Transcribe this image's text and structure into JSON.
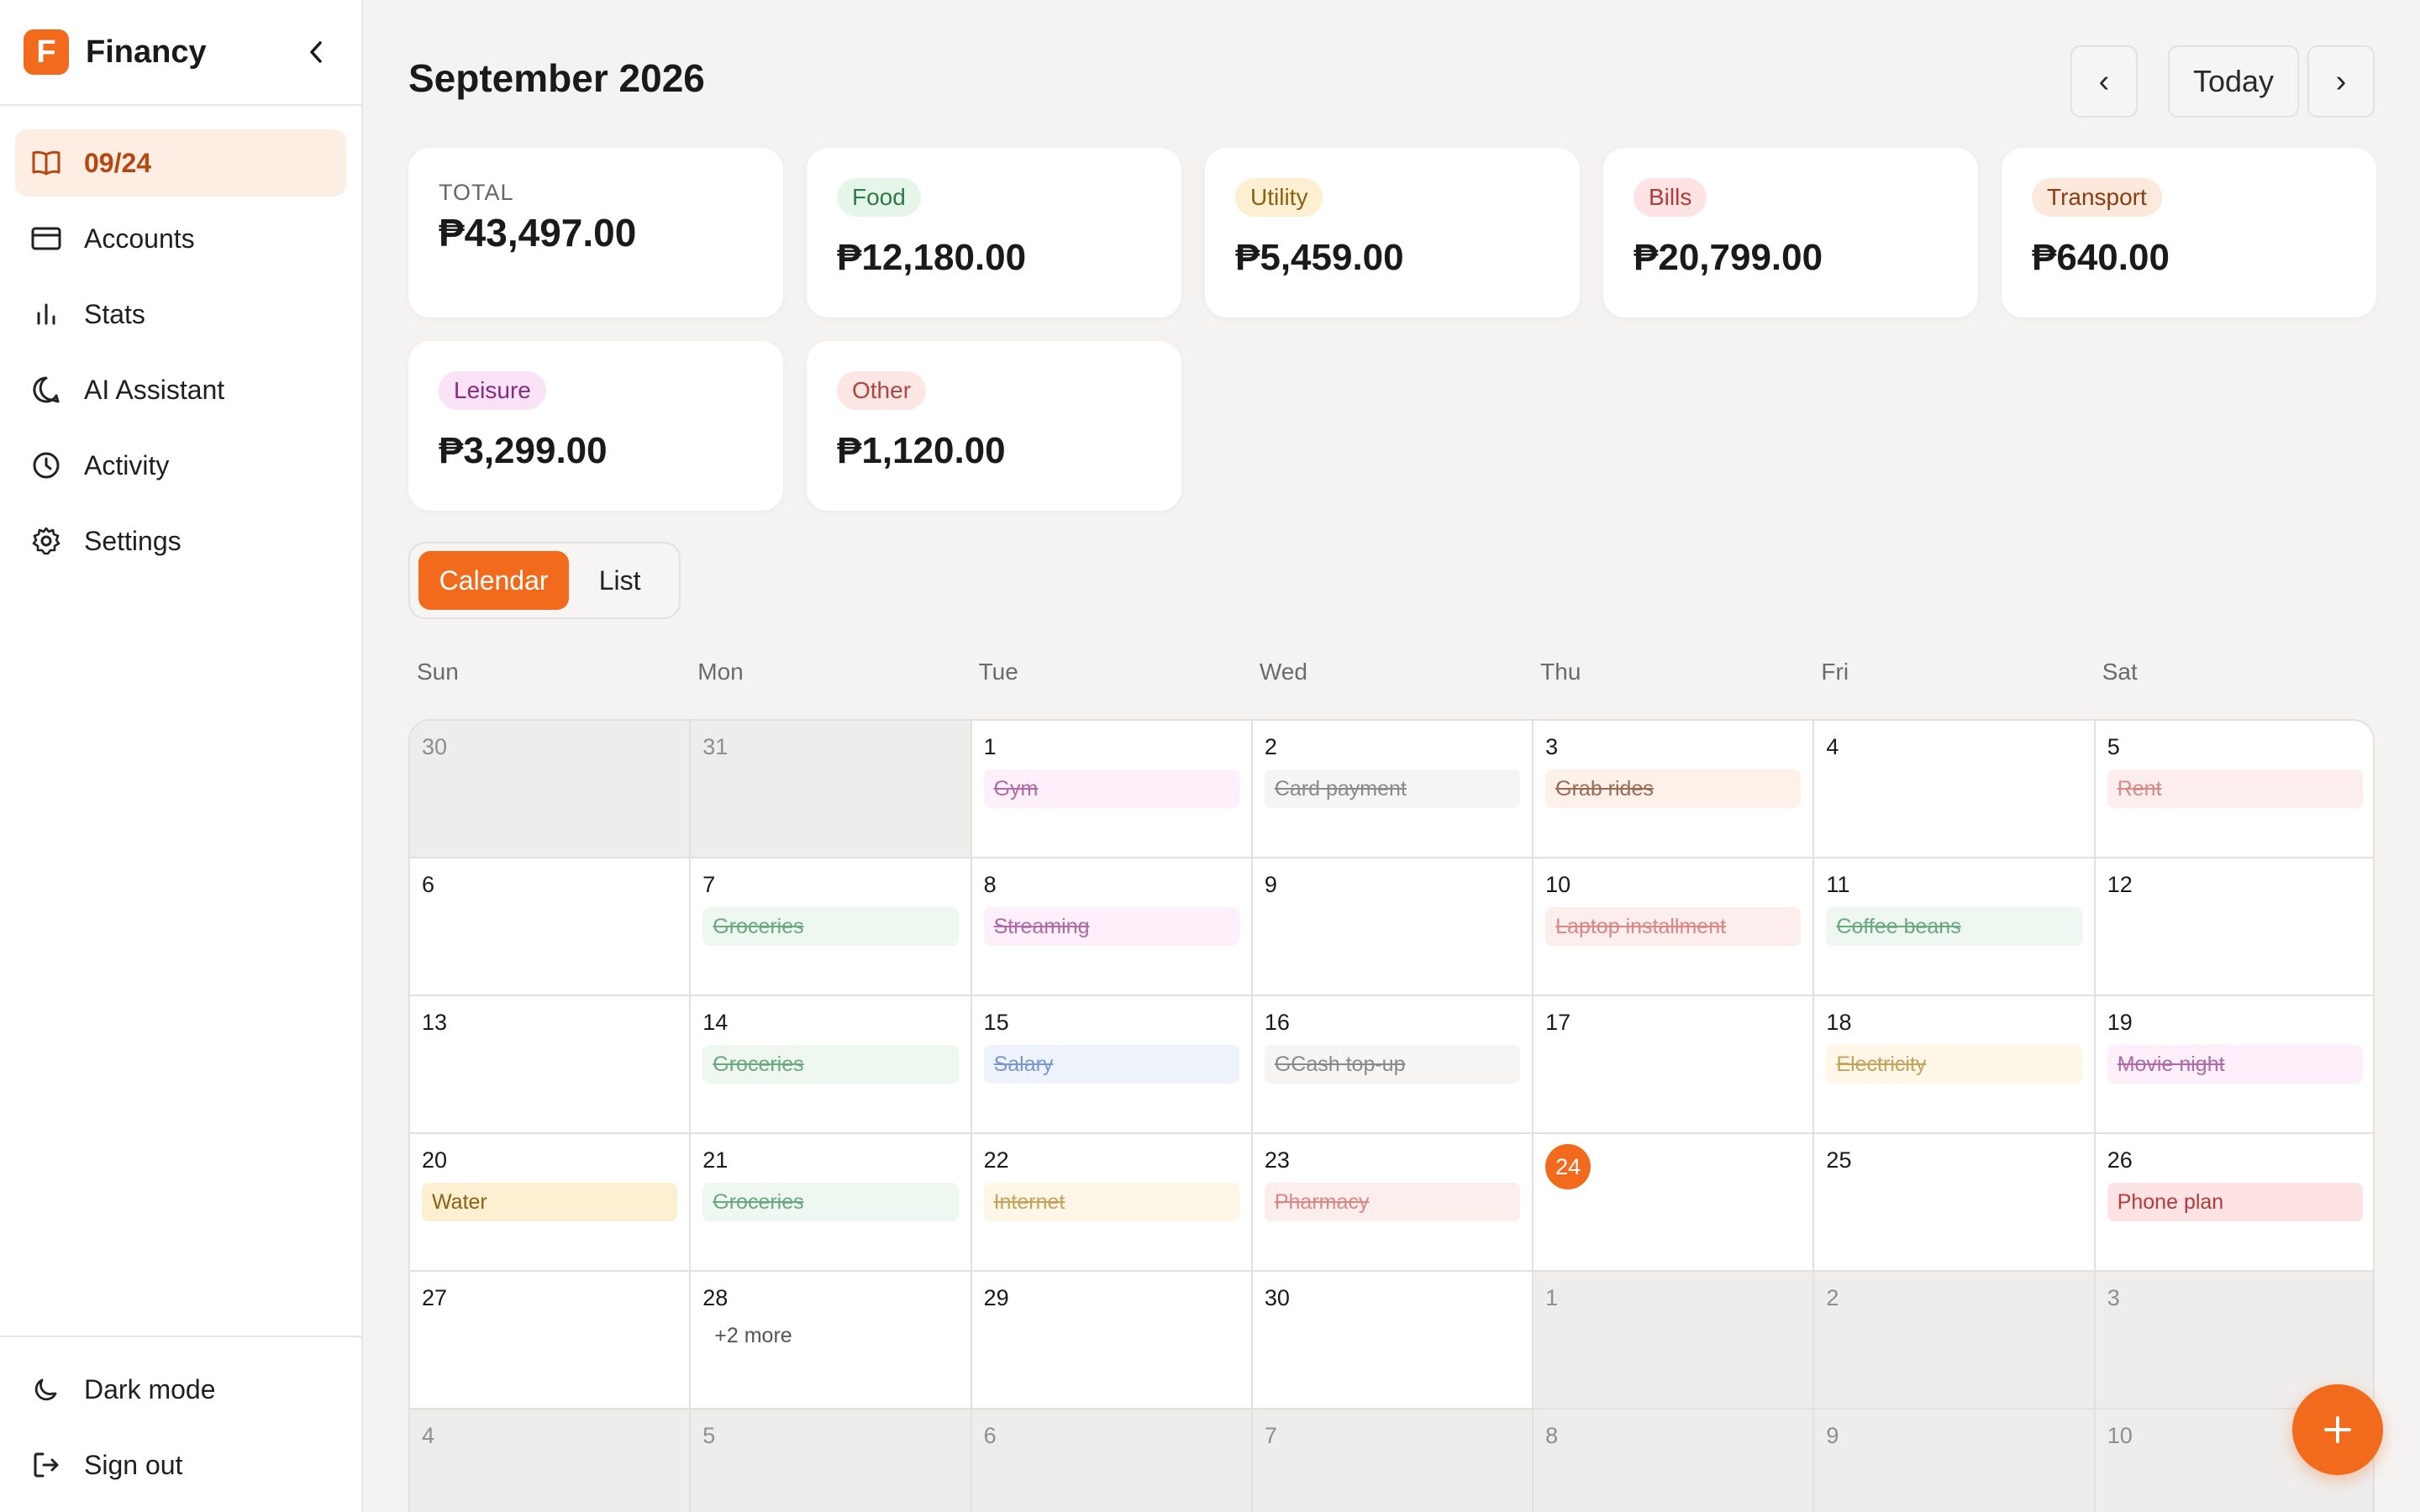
{
  "app": {
    "name": "Financy",
    "logo_letter": "F"
  },
  "sidebar": {
    "items": [
      {
        "label": "09/24",
        "icon": "book-open-icon",
        "active": true
      },
      {
        "label": "Accounts",
        "icon": "credit-card-icon"
      },
      {
        "label": "Stats",
        "icon": "bar-chart-icon"
      },
      {
        "label": "AI Assistant",
        "icon": "chat-bubble-icon"
      },
      {
        "label": "Activity",
        "icon": "clock-icon"
      },
      {
        "label": "Settings",
        "icon": "gear-icon"
      }
    ],
    "bottom": [
      {
        "label": "Dark mode",
        "icon": "moon-icon"
      },
      {
        "label": "Sign out",
        "icon": "sign-out-icon"
      }
    ]
  },
  "header": {
    "title": "September 2026",
    "today_label": "Today",
    "prev": "‹",
    "next": "›"
  },
  "summary": {
    "total_label": "TOTAL",
    "total_amount": "₱43,497.00",
    "categories": [
      {
        "name": "Food",
        "amount": "₱12,180.00",
        "bg": "#e6f5ea",
        "fg": "#2f7a45"
      },
      {
        "name": "Utility",
        "amount": "₱5,459.00",
        "bg": "#fcefd2",
        "fg": "#8a6212"
      },
      {
        "name": "Bills",
        "amount": "₱20,799.00",
        "bg": "#fde3e3",
        "fg": "#b43b3b"
      },
      {
        "name": "Transport",
        "amount": "₱640.00",
        "bg": "#fde8dc",
        "fg": "#8a3c14"
      },
      {
        "name": "Leisure",
        "amount": "₱3,299.00",
        "bg": "#fbe3f7",
        "fg": "#8b2a83"
      },
      {
        "name": "Other",
        "amount": "₱1,120.00",
        "bg": "#fde6e4",
        "fg": "#b0473f"
      }
    ]
  },
  "view_toggle": {
    "calendar": "Calendar",
    "list": "List",
    "active": "calendar"
  },
  "weekdays": [
    "Sun",
    "Mon",
    "Tue",
    "Wed",
    "Thu",
    "Fri",
    "Sat"
  ],
  "calendar": {
    "weeks": [
      [
        {
          "day": "30",
          "muted": true
        },
        {
          "day": "31",
          "muted": true
        },
        {
          "day": "1",
          "event": {
            "label": "Gym",
            "type": "leisure",
            "done": true
          }
        },
        {
          "day": "2",
          "event": {
            "label": "Card payment",
            "type": "other",
            "done": true
          }
        },
        {
          "day": "3",
          "event": {
            "label": "Grab rides",
            "type": "transport",
            "done": true
          }
        },
        {
          "day": "4"
        },
        {
          "day": "5",
          "event": {
            "label": "Rent",
            "type": "bills",
            "done": true
          }
        }
      ],
      [
        {
          "day": "6"
        },
        {
          "day": "7",
          "event": {
            "label": "Groceries",
            "type": "food",
            "done": true
          }
        },
        {
          "day": "8",
          "event": {
            "label": "Streaming",
            "type": "leisure",
            "done": true
          }
        },
        {
          "day": "9"
        },
        {
          "day": "10",
          "event": {
            "label": "Laptop installment",
            "type": "bills",
            "done": true
          }
        },
        {
          "day": "11",
          "event": {
            "label": "Coffee beans",
            "type": "food",
            "done": true
          }
        },
        {
          "day": "12"
        }
      ],
      [
        {
          "day": "13"
        },
        {
          "day": "14",
          "event": {
            "label": "Groceries",
            "type": "food",
            "done": true
          }
        },
        {
          "day": "15",
          "event": {
            "label": "Salary",
            "type": "income",
            "done": true
          }
        },
        {
          "day": "16",
          "event": {
            "label": "GCash top-up",
            "type": "other",
            "done": true
          }
        },
        {
          "day": "17"
        },
        {
          "day": "18",
          "event": {
            "label": "Electricity",
            "type": "utility",
            "done": true
          }
        },
        {
          "day": "19",
          "event": {
            "label": "Movie night",
            "type": "leisure",
            "done": true
          }
        }
      ],
      [
        {
          "day": "20",
          "event": {
            "label": "Water",
            "type": "utility_due",
            "done": false
          }
        },
        {
          "day": "21",
          "event": {
            "label": "Groceries",
            "type": "food",
            "done": true
          }
        },
        {
          "day": "22",
          "event": {
            "label": "Internet",
            "type": "utility",
            "done": true
          }
        },
        {
          "day": "23",
          "event": {
            "label": "Pharmacy",
            "type": "bills",
            "done": true
          }
        },
        {
          "day": "24",
          "today": true
        },
        {
          "day": "25"
        },
        {
          "day": "26",
          "event": {
            "label": "Phone plan",
            "type": "bills_due",
            "done": false
          }
        }
      ],
      [
        {
          "day": "27"
        },
        {
          "day": "28",
          "more": "+2 more"
        },
        {
          "day": "29"
        },
        {
          "day": "30"
        },
        {
          "day": "1",
          "muted": true
        },
        {
          "day": "2",
          "muted": true
        },
        {
          "day": "3",
          "muted": true
        }
      ],
      [
        {
          "day": "4",
          "muted": true
        },
        {
          "day": "5",
          "muted": true
        },
        {
          "day": "6",
          "muted": true
        },
        {
          "day": "7",
          "muted": true
        },
        {
          "day": "8",
          "muted": true
        },
        {
          "day": "9",
          "muted": true
        },
        {
          "day": "10",
          "muted": true
        }
      ]
    ]
  },
  "event_colors": {
    "leisure": {
      "bg": "#fdf0fb",
      "fg": "#b06aa8"
    },
    "other": {
      "bg": "#f6f5f4",
      "fg": "#8a8a8a"
    },
    "transport": {
      "bg": "#fef1ea",
      "fg": "#9a6a55"
    },
    "bills": {
      "bg": "#fdeeee",
      "fg": "#d98787"
    },
    "food": {
      "bg": "#eef7f0",
      "fg": "#6aa880"
    },
    "income": {
      "bg": "#edf2fb",
      "fg": "#7b97d1"
    },
    "utility": {
      "bg": "#fef6e6",
      "fg": "#c7a25c"
    },
    "utility_due": {
      "bg": "#fcefd2",
      "fg": "#8a6212"
    },
    "bills_due": {
      "bg": "#fde3e3",
      "fg": "#b43b3b"
    }
  },
  "fab": {
    "icon": "plus-icon"
  },
  "colors": {
    "accent": "#f26b1d"
  }
}
